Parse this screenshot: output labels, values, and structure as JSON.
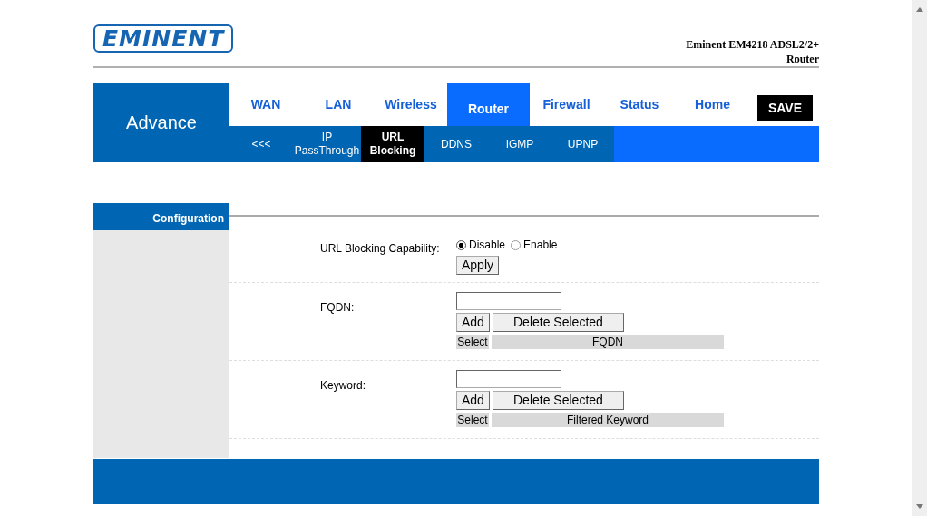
{
  "logo": {
    "text": "EMINENT"
  },
  "device_title": "Eminent EM4218 ADSL2/2+ Router",
  "section_title": "Advance",
  "tabs": [
    {
      "label": "WAN",
      "selected": false
    },
    {
      "label": "LAN",
      "selected": false
    },
    {
      "label": "Wireless",
      "selected": false
    },
    {
      "label": "Router",
      "selected": true
    },
    {
      "label": "Firewall",
      "selected": false
    },
    {
      "label": "Status",
      "selected": false
    },
    {
      "label": "Home",
      "selected": false
    }
  ],
  "save_button": "SAVE",
  "subtabs": [
    {
      "label": "<<<",
      "selected": false
    },
    {
      "label": "IP PassThrough",
      "selected": false
    },
    {
      "label": "URL Blocking",
      "selected": true
    },
    {
      "label": "DDNS",
      "selected": false
    },
    {
      "label": "IGMP",
      "selected": false
    },
    {
      "label": "UPNP",
      "selected": false
    }
  ],
  "sidebar": {
    "items": [
      {
        "label": "Configuration",
        "selected": true
      }
    ]
  },
  "capability": {
    "label": "URL Blocking Capability:",
    "options": [
      {
        "label": "Disable",
        "selected": true
      },
      {
        "label": "Enable",
        "selected": false
      }
    ],
    "apply_button": "Apply"
  },
  "lists": [
    {
      "label": "FQDN:",
      "add_button": "Add",
      "delete_button": "Delete Selected",
      "columns": [
        "Select",
        "FQDN"
      ]
    },
    {
      "label": "Keyword:",
      "add_button": "Add",
      "delete_button": "Delete Selected",
      "columns": [
        "Select",
        "Filtered Keyword"
      ]
    }
  ]
}
